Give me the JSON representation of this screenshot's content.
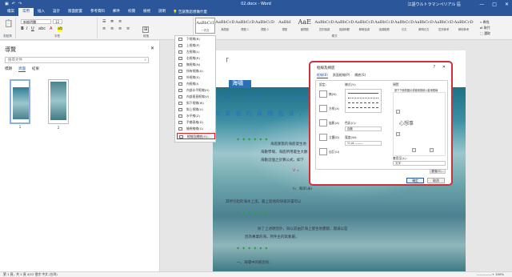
{
  "titlebar": {
    "doc_title": "02.docx - Word",
    "user": "江語ウルトラマンペリアル 區",
    "min": "—",
    "max": "□",
    "close": "✕"
  },
  "tabs": [
    "檔案",
    "常用",
    "插入",
    "設計",
    "版面配置",
    "參考資料",
    "郵件",
    "校閱",
    "檢視",
    "說明"
  ],
  "tell_me": "告訴我您想做什麼",
  "ribbon": {
    "font_name": "新細明體",
    "font_size": "12",
    "clipboard_label": "剪貼簿",
    "font_label": "字型",
    "paragraph_label": "段落",
    "styles_label": "樣式",
    "editing_label": "編輯",
    "find": "尋找",
    "replace": "取代",
    "select": "選取",
    "styles": [
      {
        "sample": "AaBbCcI",
        "name": "一內文"
      },
      {
        "sample": "AaBbCcD",
        "name": "無間距"
      },
      {
        "sample": "AaBbCcD",
        "name": "標題 1"
      },
      {
        "sample": "AaBbCcD",
        "name": "標題 2"
      },
      {
        "sample": "AaBbI",
        "name": "標題"
      },
      {
        "sample": "AaE",
        "name": "副標題"
      },
      {
        "sample": "AaBbCcD",
        "name": "區別強調"
      },
      {
        "sample": "AaBbCcD",
        "name": "強調斜體"
      },
      {
        "sample": "AaBbCcD",
        "name": "鮮明強調"
      },
      {
        "sample": "AaBbCcD",
        "name": "強調粗體"
      },
      {
        "sample": "AaBbCcD",
        "name": "引文"
      },
      {
        "sample": "AaBbCcD",
        "name": "鮮明引文"
      },
      {
        "sample": "AaBbCcD",
        "name": "區別參考"
      },
      {
        "sample": "AaBbCcD",
        "name": "鮮明參考"
      }
    ]
  },
  "nav": {
    "title": "導覽",
    "close": "✕",
    "search_placeholder": "搜尋文件",
    "tabs": [
      "標題",
      "頁面",
      "結果"
    ],
    "pages": [
      "1",
      "2"
    ]
  },
  "border_menu": [
    "下框線(B)",
    "上框線(P)",
    "左框線(L)",
    "右框線(R)",
    "無框線(N)",
    "所有框線(A)",
    "外框線(S)",
    "內框線(I)",
    "內部水平框線(H)",
    "內部垂直框線(V)",
    "斜下框線(W)",
    "斜上框線(U)",
    "水平線(Z)",
    "手繪表格(D)",
    "檢視格線(G)",
    "框線及網底(O)..."
  ],
  "document": {
    "heading_char": "「",
    "highlight": "海嘯",
    "line1": "海 嘯 （ 海 玔 ， seismic sea",
    "line2": "和 廣 義 的 兩 種 說 法 ，",
    "para1a": "海底那張的海底發生地",
    "para1b": "海數學場，海底所用最生大數",
    "para1c": "海數這個之計算公式，如下",
    "red_mark": "V =",
    "note": "h：海深(米)",
    "para2": "其所引起的海水上漲，最上陸地的快速許還可以",
    "para3a": "除了上述原因外，與以前由於海上發生地震都，期滿以是",
    "para3b": "因為專業的海，所件主的氣象屬，",
    "para4": "一、海嘯中的較因有：",
    "green_marks": "◆◆◆◆◆◆"
  },
  "dialog": {
    "title": "框線及網底",
    "help": "?",
    "close": "✕",
    "tabs": [
      "框線(B)",
      "頁面框線(P)",
      "網底(S)"
    ],
    "settings_label": "設定:",
    "settings": [
      "無(N)",
      "方框(X)",
      "陰影(A)",
      "立體(D)",
      "自訂(U)"
    ],
    "style_label": "樣式(Y):",
    "color_label": "色彩(C):",
    "color_value": "自動",
    "width_label": "寬度(W):",
    "width_value": "½ pt ———",
    "preview_label": "預覽",
    "preview_hint": "按下下面的圖示或使用按鈕以套用框線",
    "preview_text": "心想事",
    "apply_label": "套用至(L):",
    "apply_value": "文字",
    "options": "選項(O)...",
    "ok": "確定",
    "cancel": "取消"
  },
  "status": {
    "left": "第 1 頁，共 2 頁    4/22 個字    中文 (台灣)",
    "right": "—————+  100%"
  }
}
